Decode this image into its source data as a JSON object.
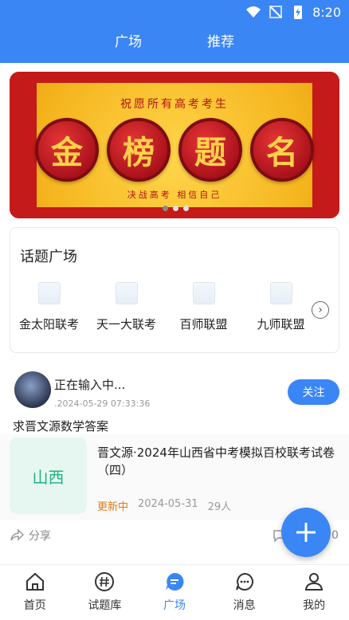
{
  "status_bar": {
    "time": "8:20"
  },
  "header": {
    "tabs": [
      "广场",
      "推荐"
    ]
  },
  "banner": {
    "slogan_top": "祝愿所有高考考生",
    "characters": [
      "金",
      "榜",
      "题",
      "名"
    ],
    "slogan_bottom": "决战高考  相信自己"
  },
  "topics": {
    "title": "话题广场",
    "items": [
      {
        "label": "金太阳联考"
      },
      {
        "label": "天一大联考"
      },
      {
        "label": "百师联盟"
      },
      {
        "label": "九师联盟"
      }
    ]
  },
  "post": {
    "user_name": "正在输入中...",
    "time": ".2024-05-29 07:33:36",
    "follow_label": "关注",
    "title": "求晋文源数学答案",
    "exam": {
      "cover_text": "山西",
      "name": "晋文源·2024年山西省中考模拟百校联考试卷（四）",
      "tag": "更新中",
      "date": "2024-05-31",
      "count": "29人"
    },
    "share_label": "分享",
    "comment_count": "0"
  },
  "bottom_nav": {
    "items": [
      {
        "label": "首页",
        "icon": "home-icon"
      },
      {
        "label": "试题库",
        "icon": "hash-icon"
      },
      {
        "label": "广场",
        "icon": "chat-bubble-icon"
      },
      {
        "label": "消息",
        "icon": "message-icon"
      },
      {
        "label": "我的",
        "icon": "user-icon"
      }
    ],
    "active_index": 2
  },
  "colors": {
    "primary": "#3a86f5",
    "accent": "#e07a10",
    "cover_green": "#23b07a"
  }
}
